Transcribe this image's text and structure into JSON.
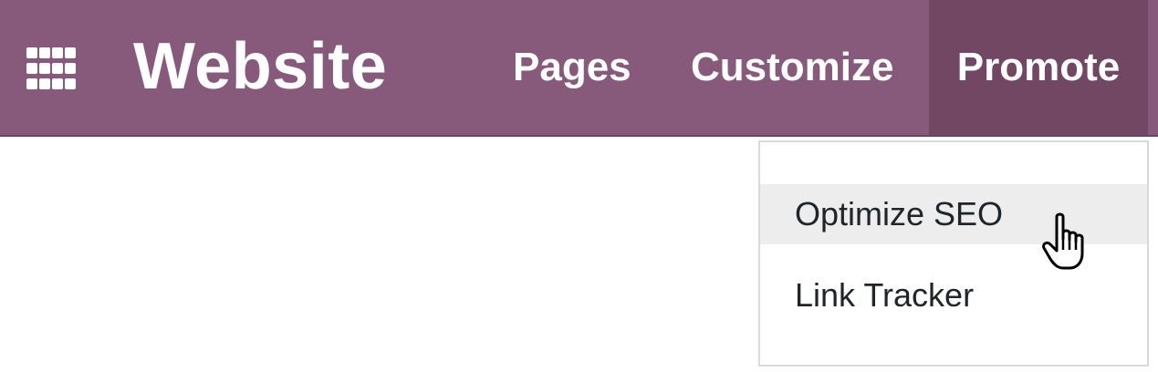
{
  "navbar": {
    "apps_icon": "apps-grid-icon",
    "brand": "Website",
    "menu": [
      {
        "label": "Pages",
        "active": false
      },
      {
        "label": "Customize",
        "active": false
      },
      {
        "label": "Promote",
        "active": true
      }
    ]
  },
  "dropdown": {
    "items": [
      {
        "label": "Optimize SEO",
        "hovered": true
      },
      {
        "label": "Link Tracker",
        "hovered": false
      }
    ]
  },
  "cursor": "hand-pointer-icon",
  "colors": {
    "navbar_bg": "#875a7b",
    "active_menu_bg": "#714763",
    "hover_bg": "#ededed",
    "menu_text": "#212529"
  }
}
